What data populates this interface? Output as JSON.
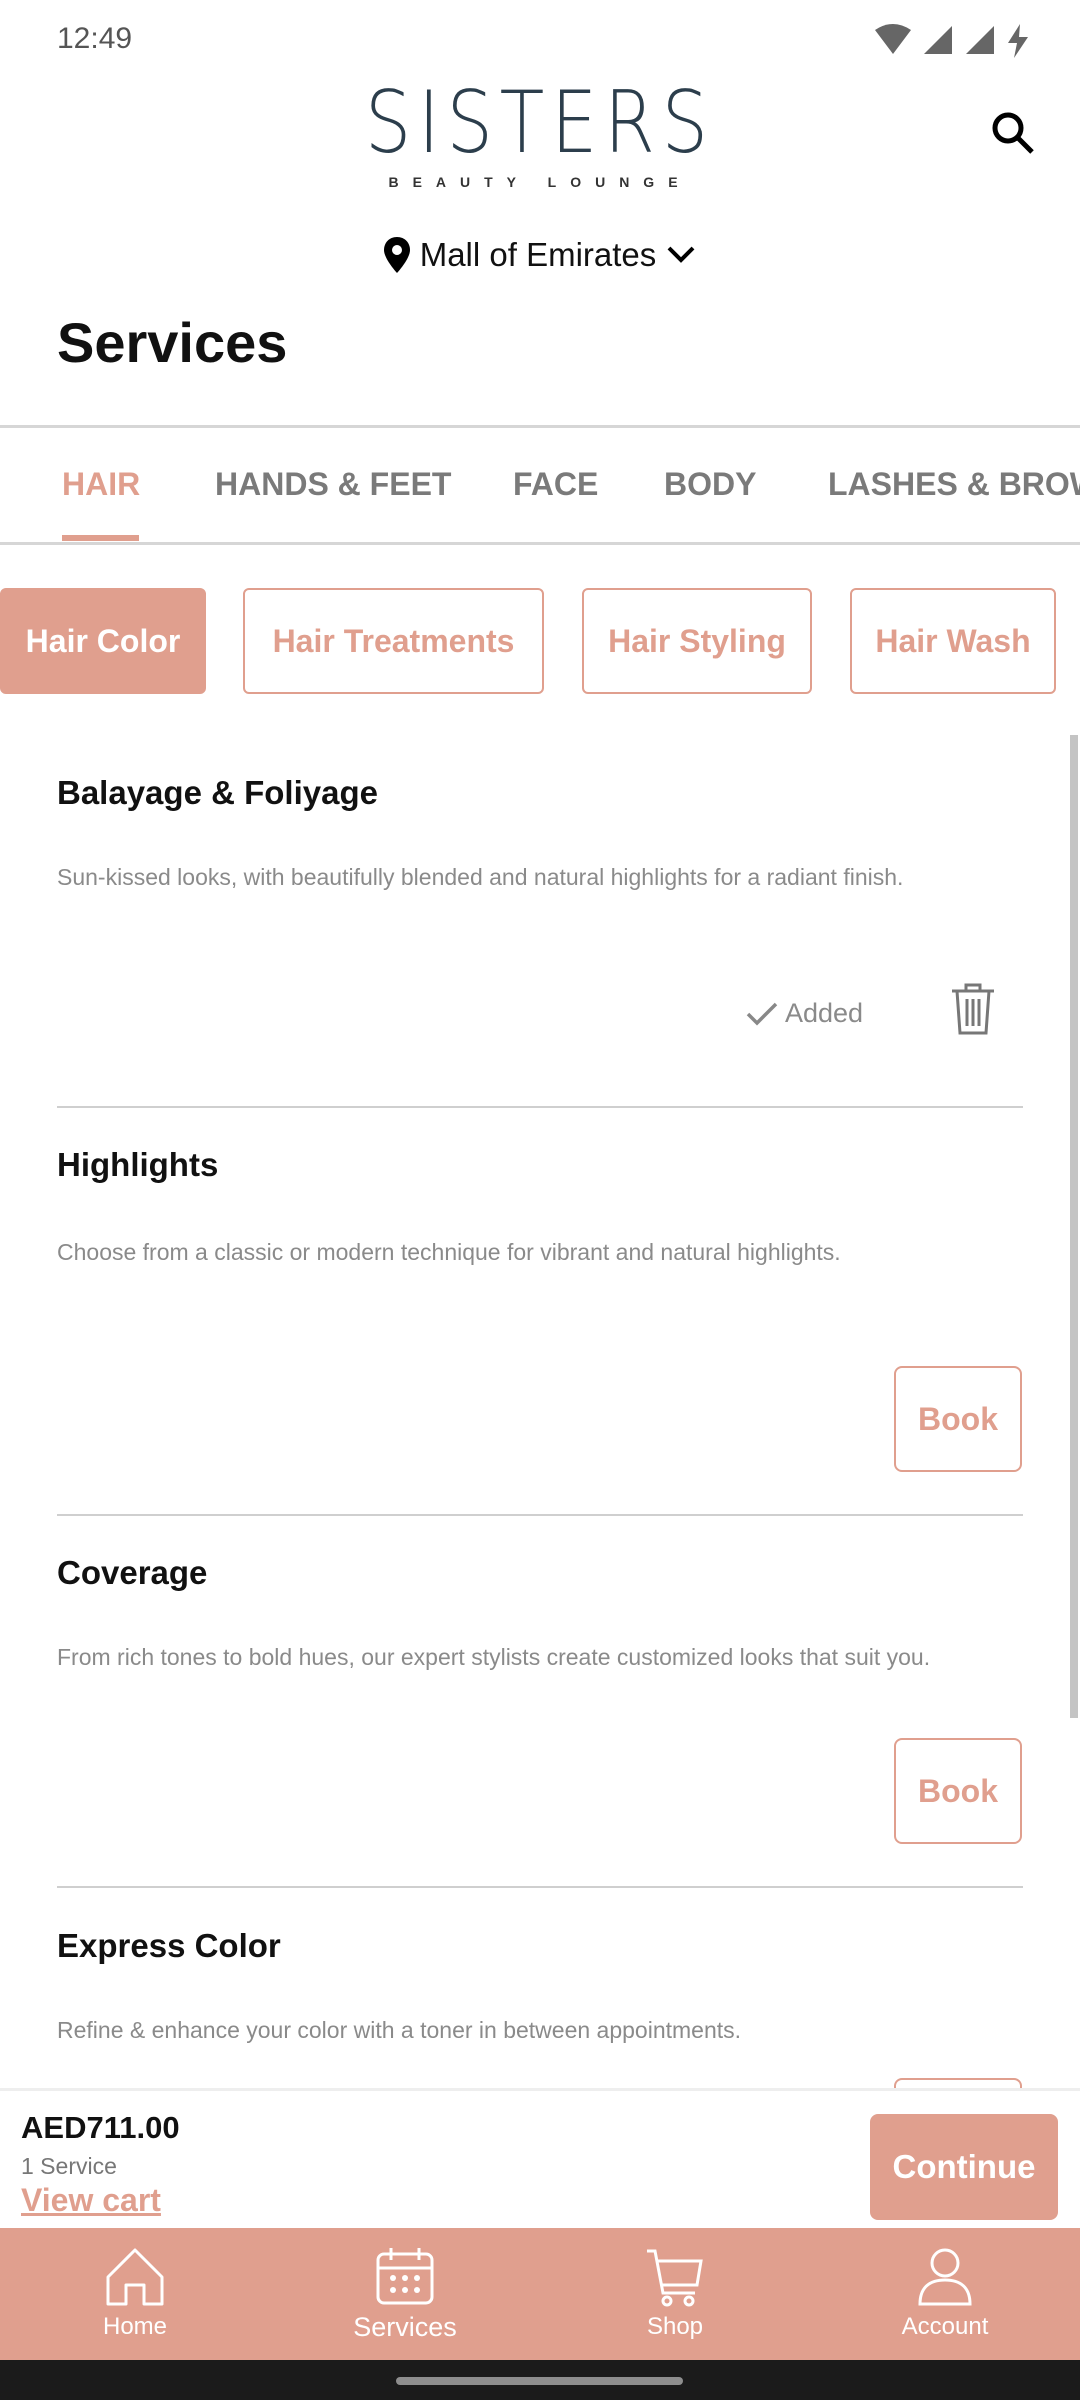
{
  "status": {
    "time": "12:49"
  },
  "brand": {
    "name": "SISTERS",
    "tagline": "BEAUTY LOUNGE"
  },
  "location": {
    "name": "Mall of Emirates"
  },
  "page_title": "Services",
  "tabs": [
    {
      "label": "HAIR",
      "active": true
    },
    {
      "label": "HANDS & FEET"
    },
    {
      "label": "FACE"
    },
    {
      "label": "BODY"
    },
    {
      "label": "LASHES & BROWS"
    }
  ],
  "chips": [
    {
      "label": "Hair Color",
      "active": true
    },
    {
      "label": "Hair Treatments"
    },
    {
      "label": "Hair Styling"
    },
    {
      "label": "Hair Wash"
    }
  ],
  "services": [
    {
      "title": "Balayage & Foliyage",
      "desc": "Sun-kissed looks, with beautifully blended and natural highlights for a radiant finish.",
      "status": "Added"
    },
    {
      "title": "Highlights",
      "desc": "Choose from a classic or modern technique for vibrant and natural highlights.",
      "action": "Book"
    },
    {
      "title": "Coverage",
      "desc": "From rich tones to bold hues, our expert stylists create customized looks that suit you.",
      "action": "Book"
    },
    {
      "title": "Express Color",
      "desc": "Refine & enhance your color with a toner in between appointments."
    }
  ],
  "cart": {
    "price": "AED711.00",
    "count": "1 Service",
    "view_label": "View cart",
    "continue_label": "Continue"
  },
  "nav": [
    {
      "label": "Home",
      "icon": "home-icon"
    },
    {
      "label": "Services",
      "icon": "calendar-icon"
    },
    {
      "label": "Shop",
      "icon": "cart-icon"
    },
    {
      "label": "Account",
      "icon": "user-icon"
    }
  ],
  "colors": {
    "accent": "#E09F8E",
    "logo": "#2C3E4C"
  }
}
